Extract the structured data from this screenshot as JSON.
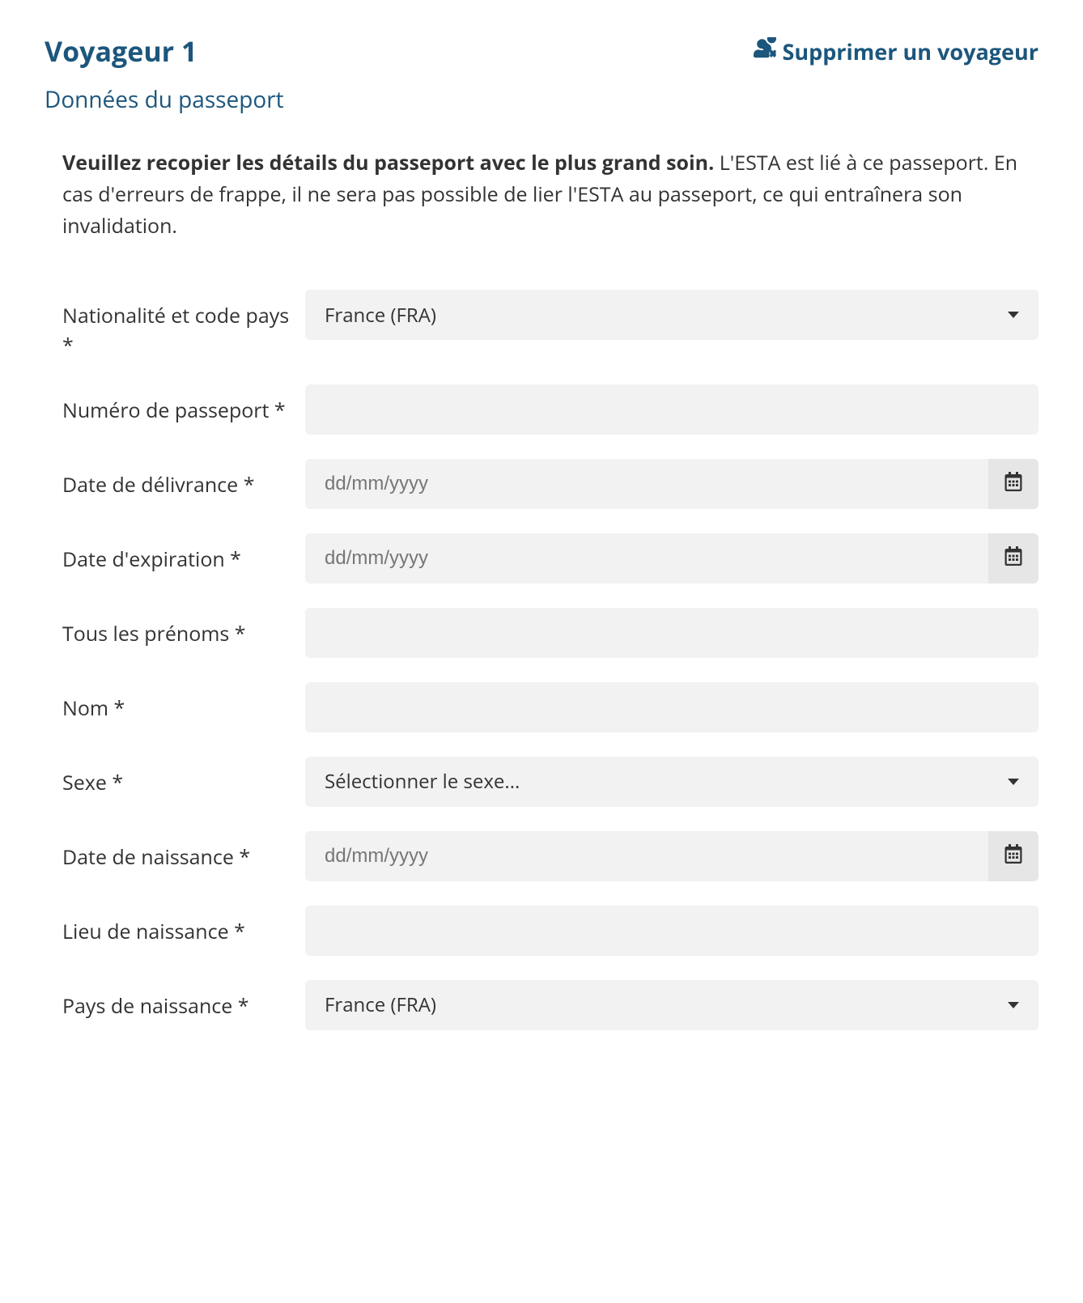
{
  "header": {
    "title": "Voyageur 1",
    "remove_label": "Supprimer un voyageur"
  },
  "subtitle": "Données du passeport",
  "instructions": {
    "bold": "Veuillez recopier les détails du passeport avec le plus grand soin.",
    "rest": " L'ESTA est lié à ce passeport. En cas d'erreurs de frappe, il ne sera pas possible de lier l'ESTA au passeport, ce qui entraînera son invalidation."
  },
  "fields": {
    "nationality": {
      "label": "Nationalité et code pays *",
      "value": "France (FRA)"
    },
    "passport_number": {
      "label": "Numéro de passeport *",
      "value": ""
    },
    "issue_date": {
      "label": "Date de délivrance *",
      "placeholder": "dd/mm/yyyy",
      "value": ""
    },
    "expiry_date": {
      "label": "Date d'expiration *",
      "placeholder": "dd/mm/yyyy",
      "value": ""
    },
    "given_names": {
      "label": "Tous les prénoms *",
      "value": ""
    },
    "surname": {
      "label": "Nom *",
      "value": ""
    },
    "sex": {
      "label": "Sexe *",
      "value": "Sélectionner le sexe..."
    },
    "birth_date": {
      "label": "Date de naissance *",
      "placeholder": "dd/mm/yyyy",
      "value": ""
    },
    "birth_place": {
      "label": "Lieu de naissance *",
      "value": ""
    },
    "birth_country": {
      "label": "Pays de naissance *",
      "value": "France (FRA)"
    }
  }
}
